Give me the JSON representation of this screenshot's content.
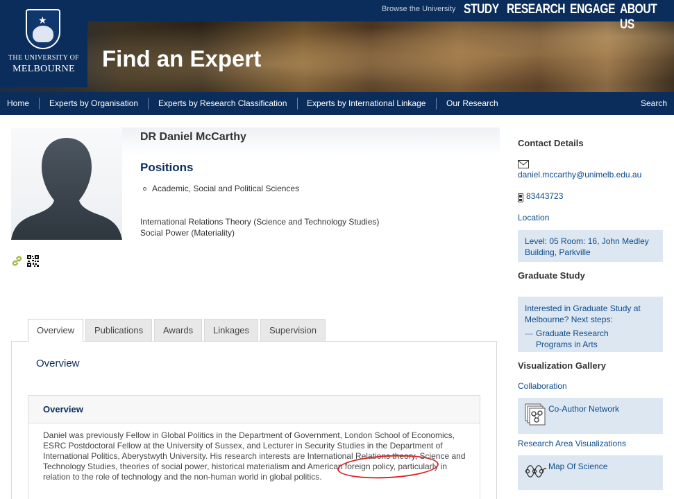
{
  "header": {
    "browse": "Browse the University",
    "topnav": [
      "STUDY",
      "RESEARCH",
      "ENGAGE",
      "ABOUT US"
    ],
    "logo_line1": "THE UNIVERSITY OF",
    "logo_line2": "MELBOURNE",
    "title": "Find an Expert"
  },
  "nav": {
    "items": [
      "Home",
      "Experts by Organisation",
      "Experts by Research Classification",
      "Experts by International Linkage",
      "Our Research"
    ],
    "search": "Search"
  },
  "profile": {
    "name": "DR Daniel McCarthy",
    "positions_heading": "Positions",
    "position": "Academic, Social and Political Sciences",
    "interests": [
      "International Relations Theory (Science and Technology Studies)",
      "Social Power (Materiality)"
    ]
  },
  "tabs": [
    "Overview",
    "Publications",
    "Awards",
    "Linkages",
    "Supervision"
  ],
  "overview": {
    "panel_title": "Overview",
    "box_title": "Overview",
    "text": "Daniel was previously Fellow in Global Politics in the Department of Government, London School of Economics, ESRC Postdoctoral Fellow at the University of Sussex, and Lecturer in Security Studies in the Department of International Politics, Aberystwyth University. His research interests are International Relations theory, Science and Technology Studies, theories of social power, historical materialism and American foreign policy, particularly in relation to the role of technology and the non-human world in global politics."
  },
  "sidebar": {
    "contact_heading": "Contact Details",
    "email": "daniel.mccarthy@unimelb.edu.au",
    "phone": "83443723",
    "location_label": "Location",
    "location": "Level: 05 Room: 16, John Medley Building, Parkville",
    "grad_heading": "Graduate Study",
    "grad_text": "Interested in Graduate Study at Melbourne? Next steps:",
    "grad_link": "Graduate Research Programs in Arts",
    "viz_heading": "Visualization Gallery",
    "collab_label": "Collaboration",
    "coauthor": "Co-Author Network",
    "research_area_label": "Research Area Visualizations",
    "map_science": "Map Of Science"
  },
  "colors": {
    "navy": "#0b2d5b",
    "link": "#0b4a8b",
    "sidebox": "#dde7f2",
    "annotation": "#d8242a"
  }
}
